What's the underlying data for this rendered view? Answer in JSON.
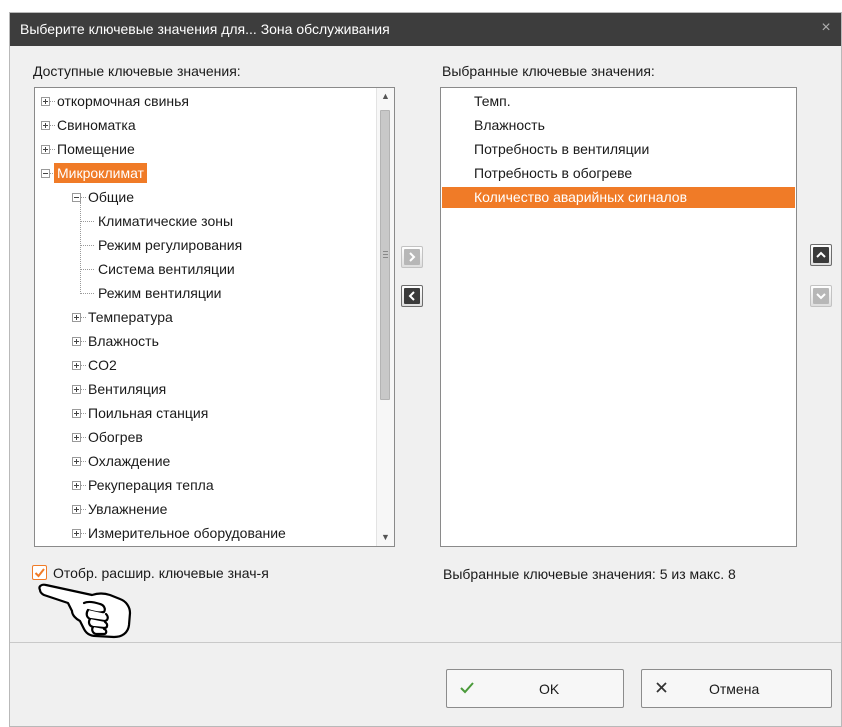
{
  "window": {
    "title": "Выберите ключевые значения для... Зона обслуживания",
    "close": "×"
  },
  "available": {
    "label": "Доступные ключевые значения:",
    "items": [
      {
        "text": "откормочная свинья",
        "level": 0,
        "expander": "plus"
      },
      {
        "text": "Свиноматка",
        "level": 0,
        "expander": "plus"
      },
      {
        "text": "Помещение",
        "level": 0,
        "expander": "plus"
      },
      {
        "text": "Микроклимат",
        "level": 0,
        "expander": "minus",
        "selected": true
      },
      {
        "text": "Общие",
        "level": 1,
        "expander": "minus"
      },
      {
        "text": "Климатические зоны",
        "level": 2,
        "expander": "none"
      },
      {
        "text": "Режим регулирования",
        "level": 2,
        "expander": "none"
      },
      {
        "text": "Система вентиляции",
        "level": 2,
        "expander": "none"
      },
      {
        "text": "Режим вентиляции",
        "level": 2,
        "expander": "none"
      },
      {
        "text": "Температура",
        "level": 1,
        "expander": "plus"
      },
      {
        "text": "Влажность",
        "level": 1,
        "expander": "plus"
      },
      {
        "text": "CO2",
        "level": 1,
        "expander": "plus"
      },
      {
        "text": "Вентиляция",
        "level": 1,
        "expander": "plus"
      },
      {
        "text": "Поильная станция",
        "level": 1,
        "expander": "plus"
      },
      {
        "text": "Обогрев",
        "level": 1,
        "expander": "plus"
      },
      {
        "text": "Охлаждение",
        "level": 1,
        "expander": "plus"
      },
      {
        "text": "Рекуперация тепла",
        "level": 1,
        "expander": "plus"
      },
      {
        "text": "Увлажнение",
        "level": 1,
        "expander": "plus"
      },
      {
        "text": "Измерительное оборудование",
        "level": 1,
        "expander": "plus"
      }
    ]
  },
  "selected": {
    "label": "Выбранные ключевые значения:",
    "items": [
      {
        "text": "Темп.",
        "active": false
      },
      {
        "text": "Влажность",
        "active": false
      },
      {
        "text": "Потребность в вентиляции",
        "active": false
      },
      {
        "text": "Потребность в обогреве",
        "active": false
      },
      {
        "text": "Количество аварийных сигналов",
        "active": true
      }
    ],
    "count_text": "Выбранные ключевые значения: 5 из макс. 8"
  },
  "options": {
    "extended_label": "Отобр. расшир. ключевые знач-я",
    "extended_checked": true
  },
  "buttons": {
    "ok": "OK",
    "cancel": "Отмена"
  },
  "colors": {
    "accent": "#f07b27",
    "titlebar": "#3d3d3d",
    "ok_check": "#4a9a3a"
  },
  "icons": {
    "add": "chevron-right-icon",
    "remove": "chevron-left-icon",
    "up": "chevron-up-icon",
    "down": "chevron-down-icon",
    "ok": "checkmark-icon",
    "cancel": "x-icon",
    "pointer": "pointing-hand-icon"
  }
}
